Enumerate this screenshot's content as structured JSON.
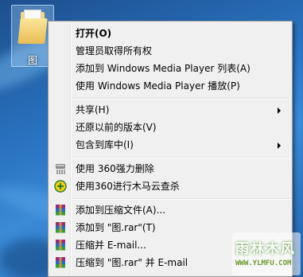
{
  "desktop": {
    "folder_label": "图"
  },
  "menu": {
    "items": [
      {
        "label": "打开(O)",
        "bold": true
      },
      {
        "label": "管理员取得所有权"
      },
      {
        "label": "添加到 Windows Media Player 列表(A)"
      },
      {
        "label": "使用 Windows Media Player 播放(P)"
      },
      {
        "label": "共享(H)",
        "submenu": true
      },
      {
        "label": "还原以前的版本(V)"
      },
      {
        "label": "包含到库中(I)",
        "submenu": true
      },
      {
        "label": "使用 360强力删除",
        "icon": "shredder-icon"
      },
      {
        "label": "使用360进行木马云查杀",
        "icon": "360-scan-icon"
      },
      {
        "label": "添加到压缩文件(A)...",
        "icon": "winrar-icon"
      },
      {
        "label": "添加到 \"图.rar\"(T)",
        "icon": "winrar-icon"
      },
      {
        "label": "压缩并 E-mail...",
        "icon": "winrar-icon"
      },
      {
        "label": "压缩到 \"图.rar\" 并 E-mail",
        "icon": "winrar-icon"
      }
    ]
  },
  "watermark": {
    "title": "雨林木风",
    "url": "WWW.YLMFU.COM"
  },
  "colors": {
    "menu_bg": "#f0f0f0",
    "menu_border": "#979797",
    "desktop_blue": "#2a74c2"
  }
}
